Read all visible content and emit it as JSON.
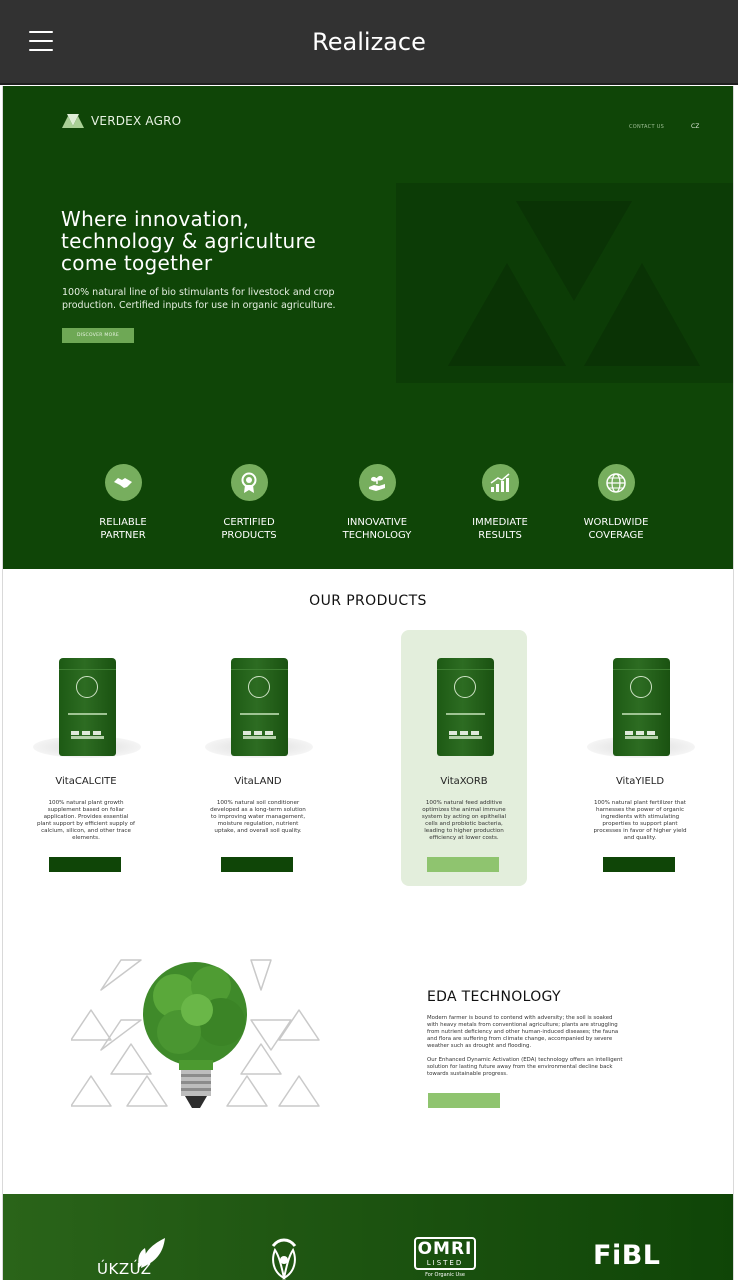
{
  "appbar": {
    "title": "Realizace",
    "menu_icon": "hamburger-icon"
  },
  "site": {
    "brand": "VERDEX AGRO",
    "nav": {
      "contact": "CONTACT US",
      "lang": "CZ"
    }
  },
  "hero": {
    "title": "Where innovation, technology & agriculture come together",
    "subtitle": "100% natural line of bio stimulants for livestock and crop production. Certified inputs for use in organic agriculture.",
    "button": "DISCOVER MORE",
    "features": [
      {
        "label": "RELIABLE\nPARTNER",
        "icon": "handshake-icon"
      },
      {
        "label": "CERTIFIED\nPRODUCTS",
        "icon": "award-ribbon-icon"
      },
      {
        "label": "INNOVATIVE\nTECHNOLOGY",
        "icon": "hand-plant-icon"
      },
      {
        "label": "IMMEDIATE\nRESULTS",
        "icon": "growth-chart-icon"
      },
      {
        "label": "WORLDWIDE\nCOVERAGE",
        "icon": "globe-icon"
      }
    ]
  },
  "products": {
    "title": "OUR PRODUCTS",
    "items": [
      {
        "name": "VitaCALCITE",
        "desc": "100% natural plant growth supplement based on foliar application. Provides essential plant support by efficient supply of calcium, silicon, and other trace elements."
      },
      {
        "name": "VitaLAND",
        "desc": "100% natural soil conditioner developed as a long-term solution to improving water management, moisture regulation, nutrient uptake, and overall soil quality."
      },
      {
        "name": "VitaXORB",
        "desc": "100% natural feed additive optimizes the animal immune system by acting on epithelial cells and probiotic bacteria, leading to higher production efficiency at lower costs."
      },
      {
        "name": "VitaYIELD",
        "desc": "100% natural plant fertilizer that harnesses the power of organic ingredients with stimulating properties to support plant processes in favor of higher yield and quality."
      }
    ]
  },
  "eda": {
    "title": "EDA TECHNOLOGY",
    "p1": "Modern farmer is bound to contend with adversity; the soil is soaked with heavy metals from conventional agriculture; plants are struggling from nutrient deficiency and other human-induced diseases; the fauna and flora are suffering from climate change, accompanied by severe weather such as drought and flooding.",
    "p2": "Our Enhanced Dynamic Activation (EDA) technology offers an intelligent solution for lasting future away from the environmental decline back towards sustainable progress."
  },
  "partners": {
    "ukzuz": "ÚKZÚZ",
    "demeter": "DEMETER",
    "omri": "OMRI",
    "omri_listed": "LISTED",
    "omri_sub": "For Organic Use",
    "fibl": "FiBL"
  },
  "colors": {
    "brand_dark": "#0f4507",
    "accent": "#77ae5e",
    "appbar": "#323232"
  }
}
